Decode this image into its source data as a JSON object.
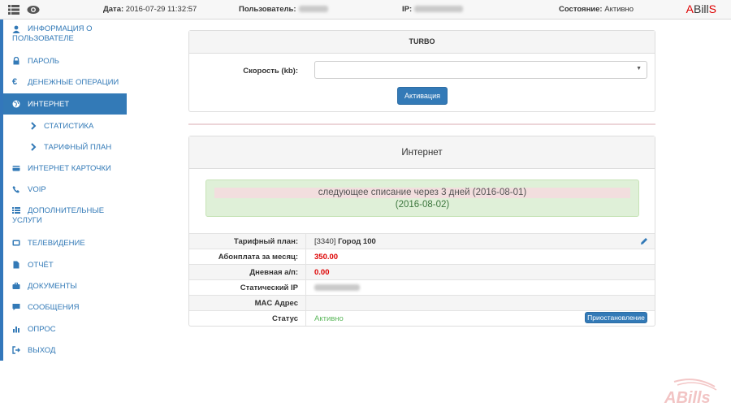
{
  "topbar": {
    "date_label": "Дата:",
    "date_value": "2016-07-29 11:32:57",
    "user_label": "Пользователь:",
    "ip_label": "IP:",
    "state_label": "Состояние:",
    "state_value": "Активно",
    "brand_a": "A",
    "brand_bill": "Bill",
    "brand_s": "S"
  },
  "sidebar": {
    "items": [
      {
        "label": "Информация о пользователе",
        "icon": "user-icon"
      },
      {
        "label": "Пароль",
        "icon": "lock-icon"
      },
      {
        "label": "Денежные операции",
        "icon": "euro-icon"
      },
      {
        "label": "Интернет",
        "icon": "globe-icon"
      },
      {
        "label": "Статистика",
        "icon": "chevron-right-icon"
      },
      {
        "label": "Тарифный план",
        "icon": "chevron-right-icon"
      },
      {
        "label": "Интернет карточки",
        "icon": "card-icon"
      },
      {
        "label": "VOIP",
        "icon": "phone-icon"
      },
      {
        "label": "Дополнительные услуги",
        "icon": "list-icon"
      },
      {
        "label": "Телевидение",
        "icon": "tv-icon"
      },
      {
        "label": "Отчёт",
        "icon": "file-icon"
      },
      {
        "label": "Документы",
        "icon": "briefcase-icon"
      },
      {
        "label": "Сообщения",
        "icon": "comment-icon"
      },
      {
        "label": "Опрос",
        "icon": "bar-chart-icon"
      },
      {
        "label": "Выход",
        "icon": "logout-icon"
      }
    ]
  },
  "turbo": {
    "title": "TURBO",
    "speed_label": "Скорость (kb):",
    "speed_value": "",
    "activate_label": "Активация"
  },
  "internet": {
    "title": "Интернет",
    "alert_line1": "следующее списание через 3 дней (2016-08-01)",
    "alert_line2": "(2016-08-02)",
    "rows": [
      {
        "key": "Тарифный план:",
        "value_prefix": "[3340]",
        "value": "Город 100"
      },
      {
        "key": "Абонплата за месяц:",
        "value": "350.00"
      },
      {
        "key": "Дневная а/п:",
        "value": "0.00"
      },
      {
        "key": "Статический IP",
        "value": ""
      },
      {
        "key": "MAC Адрес",
        "value": ""
      },
      {
        "key": "Статус",
        "value": "Активно"
      }
    ],
    "suspend_label": "Приостановление"
  },
  "colors": {
    "accent": "#337ab7",
    "active_status": "#5cb85c",
    "money": "#dd0000"
  }
}
